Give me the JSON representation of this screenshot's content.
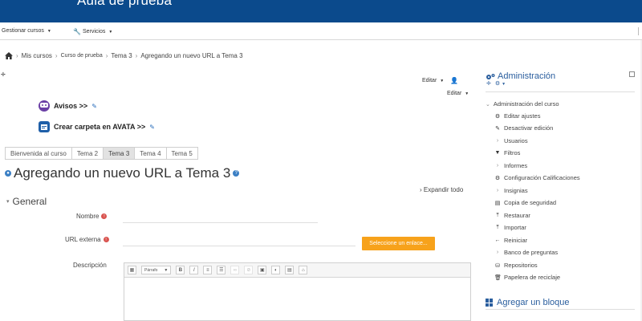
{
  "header": {
    "site_title": "Aula de prueba",
    "menu": {
      "manage_courses": "Gestionar cursos",
      "services": "Servicios"
    }
  },
  "breadcrumb": {
    "items": [
      "Mis cursos",
      "Curso de prueba",
      "Tema 3",
      "Agregando un nuevo URL a Tema 3"
    ]
  },
  "edit_controls": {
    "edit_primary": "Editar",
    "edit_secondary": "Editar"
  },
  "activities": [
    {
      "label": "Avisos >>"
    },
    {
      "label": "Crear carpeta en AVATA >>"
    }
  ],
  "tabs": [
    {
      "label": "Bienvenida al curso",
      "active": false
    },
    {
      "label": "Tema 2",
      "active": false
    },
    {
      "label": "Tema 3",
      "active": true
    },
    {
      "label": "Tema 4",
      "active": false
    },
    {
      "label": "Tema 5",
      "active": false
    }
  ],
  "page": {
    "heading": "Agregando un nuevo URL a Tema 3",
    "expand_all": "Expandir todo",
    "section_general": "General"
  },
  "form": {
    "name_label": "Nombre",
    "name_value": "",
    "url_label": "URL externa",
    "url_value": "",
    "select_link_button": "Seleccione un enlace...",
    "description_label": "Descripción",
    "editor_paragraph": "Párrafo"
  },
  "sidebar": {
    "title": "Administración",
    "section": "Administración del curso",
    "items": [
      {
        "label": "Editar ajustes",
        "icon": "gear-icon",
        "kind": "link"
      },
      {
        "label": "Desactivar edición",
        "icon": "pencil-icon",
        "kind": "link"
      },
      {
        "label": "Usuarios",
        "icon": "chevron-right-icon",
        "kind": "branch"
      },
      {
        "label": "Filtros",
        "icon": "filter-icon",
        "kind": "link"
      },
      {
        "label": "Informes",
        "icon": "chevron-right-icon",
        "kind": "branch"
      },
      {
        "label": "Configuración Calificaciones",
        "icon": "gear-icon",
        "kind": "link"
      },
      {
        "label": "Insignias",
        "icon": "chevron-right-icon",
        "kind": "branch"
      },
      {
        "label": "Copia de seguridad",
        "icon": "backup-icon",
        "kind": "link"
      },
      {
        "label": "Restaurar",
        "icon": "upload-icon",
        "kind": "link"
      },
      {
        "label": "Importar",
        "icon": "upload-icon",
        "kind": "link"
      },
      {
        "label": "Reiniciar",
        "icon": "arrow-left-icon",
        "kind": "link"
      },
      {
        "label": "Banco de preguntas",
        "icon": "chevron-right-icon",
        "kind": "branch"
      },
      {
        "label": "Repositorios",
        "icon": "repository-icon",
        "kind": "link"
      },
      {
        "label": "Papelera de reciclaje",
        "icon": "trash-icon",
        "kind": "link"
      }
    ],
    "add_block": "Agregar un bloque"
  },
  "colors": {
    "banner": "#0b4a8c",
    "accent": "#2a5e9e",
    "button_orange": "#f7a21b",
    "required": "#d9534f"
  }
}
